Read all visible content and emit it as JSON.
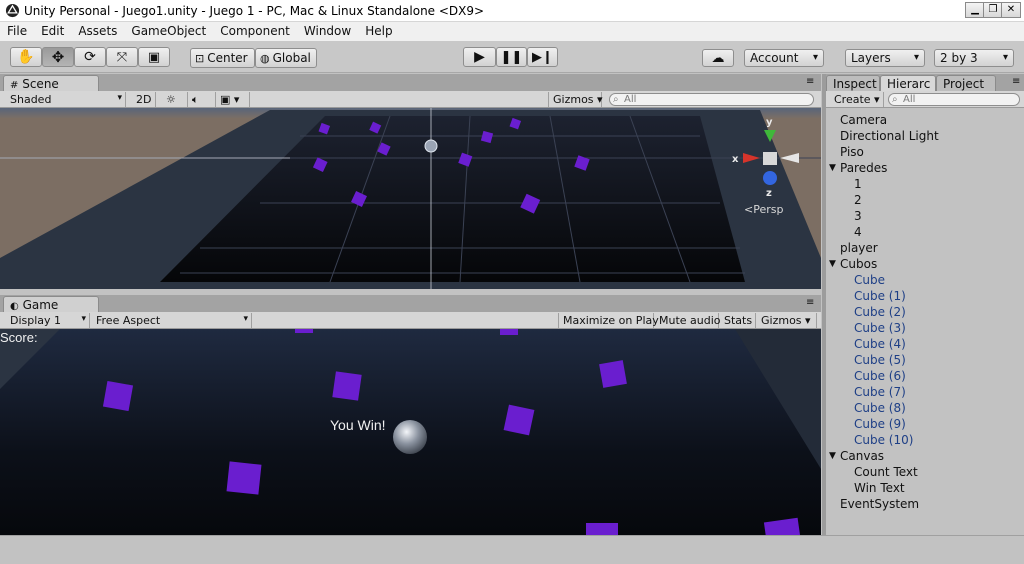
{
  "window": {
    "title": "Unity Personal - Juego1.unity - Juego 1 - PC, Mac & Linux Standalone <DX9>",
    "controls": [
      "▁",
      "❐",
      "✕"
    ]
  },
  "menu": [
    "File",
    "Edit",
    "Assets",
    "GameObject",
    "Component",
    "Window",
    "Help"
  ],
  "toolbar": {
    "pivot_label": "Center",
    "space_label": "Global",
    "account_label": "Account",
    "layers_label": "Layers",
    "layout_label": "2 by 3"
  },
  "scene": {
    "tab_label": "Scene",
    "shading_label": "Shaded",
    "mode_2d_label": "2D",
    "gizmos_label": "Gizmos",
    "search_placeholder": "All",
    "gizmo_axes": {
      "y": "y",
      "x": "x",
      "z": "z"
    },
    "persp_label": "Persp"
  },
  "game": {
    "tab_label": "Game",
    "display_label": "Display 1",
    "aspect_label": "Free Aspect",
    "maximize_label": "Maximize on Play",
    "mute_label": "Mute audio",
    "stats_label": "Stats",
    "gizmos_label": "Gizmos",
    "score_text": "Score:",
    "win_text": "You Win!"
  },
  "right_panel": {
    "tabs": [
      "Inspect",
      "Hierarc",
      "Project"
    ],
    "create_label": "Create",
    "search_placeholder": "All"
  },
  "hierarchy": [
    {
      "label": "Camera",
      "indent": 0,
      "expand": ""
    },
    {
      "label": "Directional Light",
      "indent": 0,
      "expand": ""
    },
    {
      "label": "Piso",
      "indent": 0,
      "expand": ""
    },
    {
      "label": "Paredes",
      "indent": 0,
      "expand": "open"
    },
    {
      "label": "1",
      "indent": 1,
      "expand": ""
    },
    {
      "label": "2",
      "indent": 1,
      "expand": ""
    },
    {
      "label": "3",
      "indent": 1,
      "expand": ""
    },
    {
      "label": "4",
      "indent": 1,
      "expand": ""
    },
    {
      "label": "player",
      "indent": 0,
      "expand": ""
    },
    {
      "label": "Cubos",
      "indent": 0,
      "expand": "open"
    },
    {
      "label": "Cube",
      "indent": 1,
      "expand": "",
      "prefab": true
    },
    {
      "label": "Cube (1)",
      "indent": 1,
      "expand": "",
      "prefab": true
    },
    {
      "label": "Cube (2)",
      "indent": 1,
      "expand": "",
      "prefab": true
    },
    {
      "label": "Cube (3)",
      "indent": 1,
      "expand": "",
      "prefab": true
    },
    {
      "label": "Cube (4)",
      "indent": 1,
      "expand": "",
      "prefab": true
    },
    {
      "label": "Cube (5)",
      "indent": 1,
      "expand": "",
      "prefab": true
    },
    {
      "label": "Cube (6)",
      "indent": 1,
      "expand": "",
      "prefab": true
    },
    {
      "label": "Cube (7)",
      "indent": 1,
      "expand": "",
      "prefab": true
    },
    {
      "label": "Cube (8)",
      "indent": 1,
      "expand": "",
      "prefab": true
    },
    {
      "label": "Cube (9)",
      "indent": 1,
      "expand": "",
      "prefab": true
    },
    {
      "label": "Cube (10)",
      "indent": 1,
      "expand": "",
      "prefab": true
    },
    {
      "label": "Canvas",
      "indent": 0,
      "expand": "open"
    },
    {
      "label": "Count Text",
      "indent": 1,
      "expand": ""
    },
    {
      "label": "Win Text",
      "indent": 1,
      "expand": ""
    },
    {
      "label": "EventSystem",
      "indent": 0,
      "expand": ""
    }
  ],
  "colors": {
    "cube": "#6a1ecf",
    "cube_light": "#8f3cf0",
    "floor": "#0b0d13",
    "wall": "#2b3442",
    "ground": "#7c6e63",
    "sky": "#5f6c82",
    "prefab_text": "#1e3f86"
  }
}
